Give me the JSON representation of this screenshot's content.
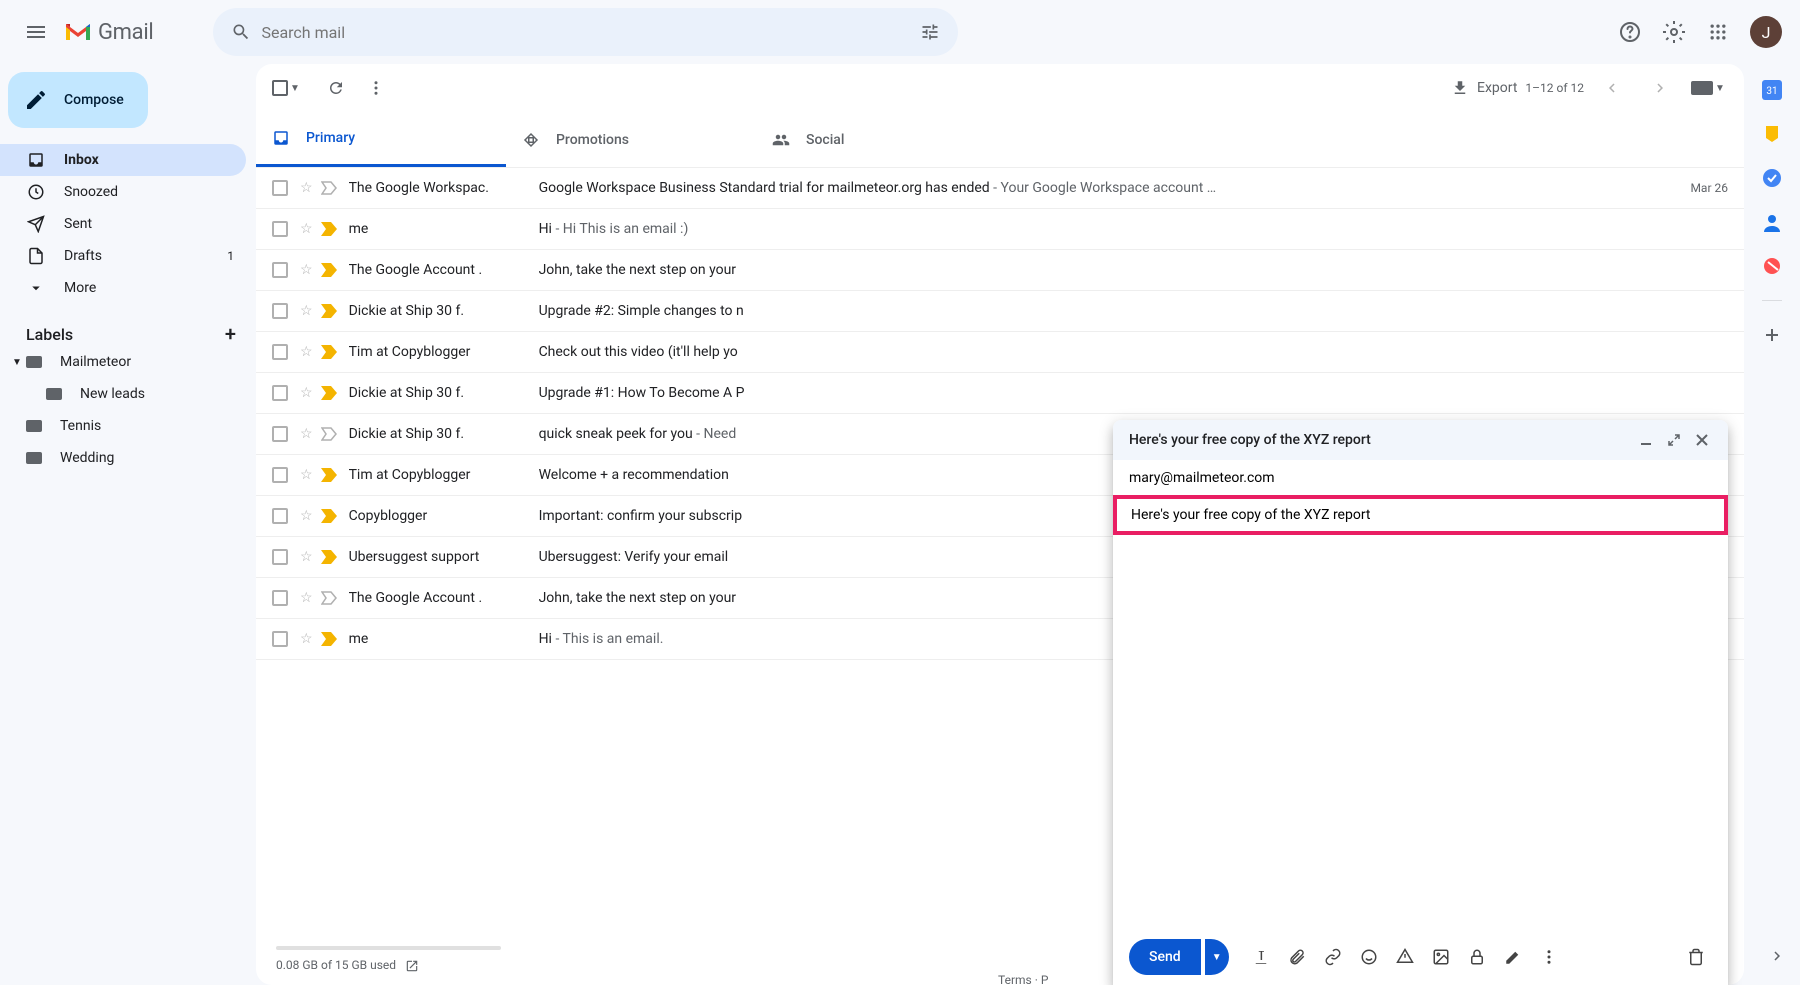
{
  "header": {
    "app_name": "Gmail",
    "search_placeholder": "Search mail",
    "avatar_initial": "J"
  },
  "sidebar": {
    "compose_label": "Compose",
    "nav": [
      {
        "label": "Inbox",
        "icon": "inbox",
        "active": true
      },
      {
        "label": "Snoozed",
        "icon": "clock"
      },
      {
        "label": "Sent",
        "icon": "send"
      },
      {
        "label": "Drafts",
        "icon": "draft",
        "count": "1"
      },
      {
        "label": "More",
        "icon": "expand"
      }
    ],
    "labels_header": "Labels",
    "labels": [
      {
        "label": "Mailmeteor",
        "expand": true
      },
      {
        "label": "New leads",
        "child": true
      },
      {
        "label": "Tennis"
      },
      {
        "label": "Wedding"
      }
    ]
  },
  "toolbar": {
    "export_label": "Export",
    "pagination": "1–12 of 12"
  },
  "tabs": [
    {
      "label": "Primary",
      "active": true
    },
    {
      "label": "Promotions"
    },
    {
      "label": "Social"
    }
  ],
  "rows": [
    {
      "sender": "The Google Workspac.",
      "subject": "Google Workspace Business Standard trial for mailmeteor.org has ended",
      "snippet": "Your Google Workspace account …",
      "date": "Mar 26",
      "imp": false
    },
    {
      "sender": "me",
      "subject": "Hi",
      "snippet": "Hi This is an email :)",
      "imp": true
    },
    {
      "sender": "The Google Account .",
      "subject": "John, take the next step on your",
      "snippet": "",
      "imp": true
    },
    {
      "sender": "Dickie at Ship 30 f.",
      "subject": "Upgrade #2: Simple changes to n",
      "snippet": "",
      "imp": true
    },
    {
      "sender": "Tim at Copyblogger",
      "subject": "Check out this video (it'll help yo",
      "snippet": "",
      "imp": true
    },
    {
      "sender": "Dickie at Ship 30 f.",
      "subject": "Upgrade #1: How To Become A P",
      "snippet": "",
      "imp": true
    },
    {
      "sender": "Dickie at Ship 30 f.",
      "subject": "quick sneak peek for you",
      "snippet": "Need",
      "imp": false
    },
    {
      "sender": "Tim at Copyblogger",
      "subject": "Welcome + a recommendation",
      "snippet": "",
      "imp": true
    },
    {
      "sender": "Copyblogger",
      "subject": "Important: confirm your subscrip",
      "snippet": "",
      "imp": true
    },
    {
      "sender": "Ubersuggest support",
      "subject": "Ubersuggest: Verify your email",
      "snippet": "",
      "imp": true
    },
    {
      "sender": "The Google Account .",
      "subject": "John, take the next step on your",
      "snippet": "",
      "imp": false
    },
    {
      "sender": "me",
      "subject": "Hi",
      "snippet": "This is an email.",
      "imp": true
    }
  ],
  "footer": {
    "storage": "0.08 GB of 15 GB used",
    "links": "Terms · P"
  },
  "compose": {
    "title": "Here's your free copy of the XYZ report",
    "to": "mary@mailmeteor.com",
    "subject": "Here's your free copy of the XYZ report",
    "send_label": "Send"
  }
}
